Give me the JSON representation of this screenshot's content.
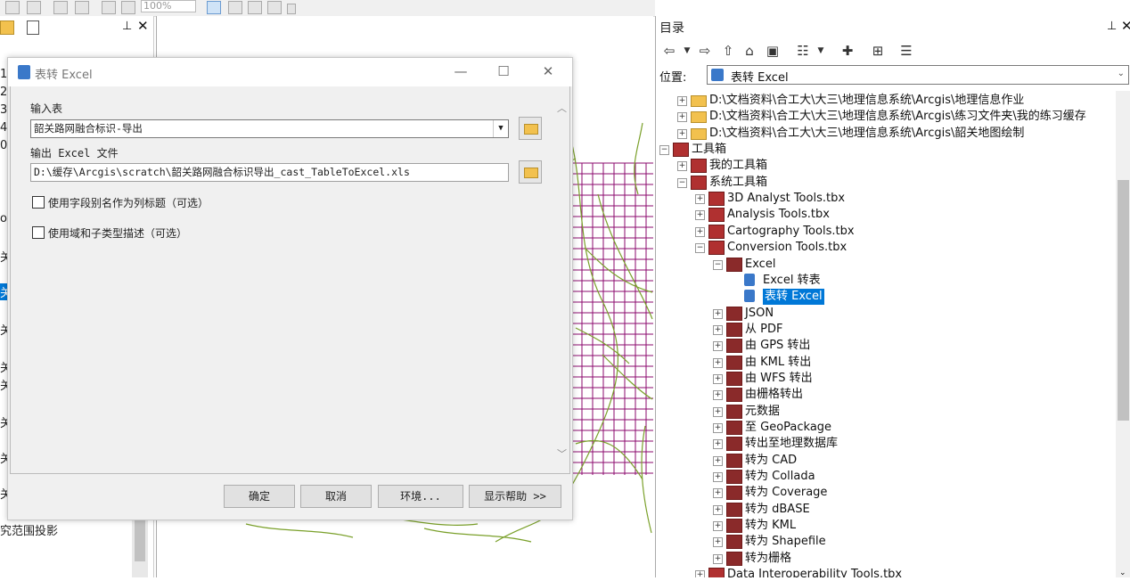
{
  "toolbar": {
    "zoom": "100%"
  },
  "left_panel": {
    "fragments": [
      "1",
      "2",
      "3",
      "4",
      "02",
      "oa",
      "关",
      "关",
      "关",
      "关",
      "关",
      "关",
      "关",
      "关",
      "关"
    ],
    "bottom_text": "究范围投影"
  },
  "dialog": {
    "title": "表转 Excel",
    "input_label": "输入表",
    "input_value": "韶关路网融合标识-导出",
    "output_label": "输出 Excel 文件",
    "output_value": "D:\\缓存\\Arcgis\\scratch\\韶关路网融合标识导出_cast_TableToExcel.xls",
    "checkbox1": "使用字段别名作为列标题（可选）",
    "checkbox2": "使用域和子类型描述（可选）",
    "buttons": {
      "ok": "确定",
      "cancel": "取消",
      "env": "环境...",
      "help": "显示帮助 >>"
    }
  },
  "catalog": {
    "title": "目录",
    "location_label": "位置:",
    "location_value": "表转 Excel",
    "tree": [
      {
        "label": "D:\\文档资料\\合工大\\大三\\地理信息系统\\Arcgis\\地理信息作业",
        "indent": 0,
        "exp": "+",
        "icon": "folder"
      },
      {
        "label": "D:\\文档资料\\合工大\\大三\\地理信息系统\\Arcgis\\练习文件夹\\我的练习缓存",
        "indent": 0,
        "exp": "+",
        "icon": "folder"
      },
      {
        "label": "D:\\文档资料\\合工大\\大三\\地理信息系统\\Arcgis\\韶关地图绘制",
        "indent": 0,
        "exp": "+",
        "icon": "folder"
      },
      {
        "label": "工具箱",
        "indent": -1,
        "exp": "−",
        "icon": "tbx"
      },
      {
        "label": "我的工具箱",
        "indent": 0,
        "exp": "+",
        "icon": "tbx"
      },
      {
        "label": "系统工具箱",
        "indent": 0,
        "exp": "−",
        "icon": "tbx"
      },
      {
        "label": "3D Analyst Tools.tbx",
        "indent": 1,
        "exp": "+",
        "icon": "tbx"
      },
      {
        "label": "Analysis Tools.tbx",
        "indent": 1,
        "exp": "+",
        "icon": "tbx"
      },
      {
        "label": "Cartography Tools.tbx",
        "indent": 1,
        "exp": "+",
        "icon": "tbx"
      },
      {
        "label": "Conversion Tools.tbx",
        "indent": 1,
        "exp": "−",
        "icon": "tbx"
      },
      {
        "label": "Excel",
        "indent": 2,
        "exp": "−",
        "icon": "toolset"
      },
      {
        "label": "Excel 转表",
        "indent": 3,
        "exp": "",
        "icon": "tool"
      },
      {
        "label": "表转 Excel",
        "indent": 3,
        "exp": "",
        "icon": "tool",
        "selected": true
      },
      {
        "label": "JSON",
        "indent": 2,
        "exp": "+",
        "icon": "toolset"
      },
      {
        "label": "从 PDF",
        "indent": 2,
        "exp": "+",
        "icon": "toolset"
      },
      {
        "label": "由 GPS 转出",
        "indent": 2,
        "exp": "+",
        "icon": "toolset"
      },
      {
        "label": "由 KML 转出",
        "indent": 2,
        "exp": "+",
        "icon": "toolset"
      },
      {
        "label": "由 WFS 转出",
        "indent": 2,
        "exp": "+",
        "icon": "toolset"
      },
      {
        "label": "由栅格转出",
        "indent": 2,
        "exp": "+",
        "icon": "toolset"
      },
      {
        "label": "元数据",
        "indent": 2,
        "exp": "+",
        "icon": "toolset"
      },
      {
        "label": "至 GeoPackage",
        "indent": 2,
        "exp": "+",
        "icon": "toolset"
      },
      {
        "label": "转出至地理数据库",
        "indent": 2,
        "exp": "+",
        "icon": "toolset"
      },
      {
        "label": "转为 CAD",
        "indent": 2,
        "exp": "+",
        "icon": "toolset"
      },
      {
        "label": "转为 Collada",
        "indent": 2,
        "exp": "+",
        "icon": "toolset"
      },
      {
        "label": "转为 Coverage",
        "indent": 2,
        "exp": "+",
        "icon": "toolset"
      },
      {
        "label": "转为 dBASE",
        "indent": 2,
        "exp": "+",
        "icon": "toolset"
      },
      {
        "label": "转为 KML",
        "indent": 2,
        "exp": "+",
        "icon": "toolset"
      },
      {
        "label": "转为 Shapefile",
        "indent": 2,
        "exp": "+",
        "icon": "toolset"
      },
      {
        "label": "转为栅格",
        "indent": 2,
        "exp": "+",
        "icon": "toolset"
      },
      {
        "label": "Data Interoperability Tools.tbx",
        "indent": 1,
        "exp": "+",
        "icon": "tbx"
      }
    ]
  },
  "colors": {
    "selection": "#0078d7",
    "map_grid": "#8b0a6e",
    "map_roads": "#7aa02a"
  }
}
